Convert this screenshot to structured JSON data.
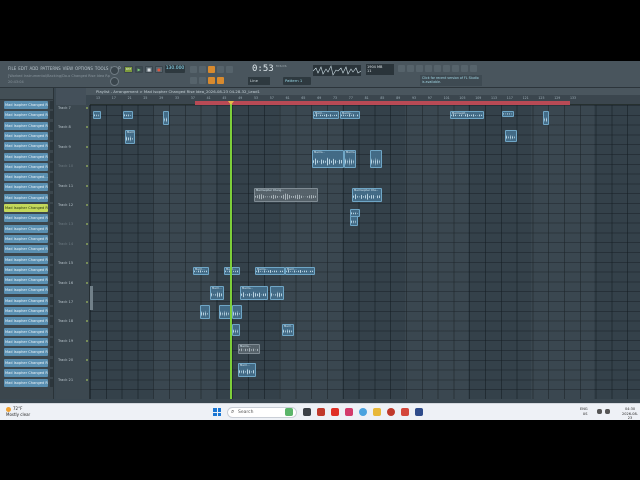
{
  "menu": [
    "FILE",
    "EDIT",
    "ADD",
    "PATTERNS",
    "VIEW",
    "OPTIONS",
    "TOOLS",
    "HELP"
  ],
  "project": {
    "title": "[Worked Instrumental/Backing/Do.o Changed Rise Idea Rp",
    "subtitle": "20:43:04"
  },
  "transport": {
    "pat_label": "PAT",
    "song_label": "SONG",
    "tempo": "130.000",
    "time": "0:53",
    "time_unit": "M:S:CS",
    "snap": "Line",
    "pattern": "Pattern 1"
  },
  "cpu": {
    "value": "1904 MB",
    "voices": "11"
  },
  "hint": "Click for recent version of FL Studio is available.",
  "playlist": {
    "title": "Playlist - Arrangement > Mad Isopher Changed Rise Idea_2026-08-23 04-28-32_Lead1"
  },
  "browser_items": [
    "Mad Isopher Changed Rise",
    "Mad Isopher Changed Rise",
    "Mad Isopher Changed Rise",
    "Mad Isopher Changed Rise",
    "Mad Isopher Changed Rise",
    "Mad Isopher Changed Rise",
    "Mad Isopher Changed Rise",
    "Mad Isopher Changed...",
    "Mad Isopher Changed Rise",
    "Mad Isopher Changed Rise",
    "Mad Isopher Changed Rise",
    "Mad Isopher Changed Rise",
    "Mad Isopher Changed Rise",
    "Mad Isopher Changed Rise",
    "Mad Isopher Changed Rise",
    "Mad Isopher Changed Rise",
    "Mad Isopher Changed Rise",
    "Mad Isopher Changed Rise",
    "Mad Isopher Changed Rise",
    "Mad Isopher Changed Rise",
    "Mad Isopher Changed Rise",
    "Mad Isopher Changed Rise",
    "Mad Isopher Changed Rise",
    "Mad Isopher Changed Rise",
    "Mad Isopher Changed Rise",
    "Mad Isopher Changed Rise",
    "Mad Isopher Changed Rise",
    "Mad Isopher Changed Rise"
  ],
  "selected_browser_index": 10,
  "tracks": [
    {
      "name": "Track 7",
      "dim": false
    },
    {
      "name": "Track 8",
      "dim": false
    },
    {
      "name": "Track 9",
      "dim": false
    },
    {
      "name": "Track 10",
      "dim": true
    },
    {
      "name": "Track 11",
      "dim": false
    },
    {
      "name": "Track 12",
      "dim": false
    },
    {
      "name": "Track 13",
      "dim": true
    },
    {
      "name": "Track 14",
      "dim": true
    },
    {
      "name": "Track 15",
      "dim": false
    },
    {
      "name": "Track 16",
      "dim": false
    },
    {
      "name": "Track 17",
      "dim": false
    },
    {
      "name": "Track 18",
      "dim": false
    },
    {
      "name": "Track 19",
      "dim": false
    },
    {
      "name": "Track 20",
      "dim": false
    },
    {
      "name": "Track 21",
      "dim": false
    }
  ],
  "ruler_numbers": [
    "13",
    "17",
    "21",
    "25",
    "29",
    "33",
    "37",
    "41",
    "45",
    "49",
    "53",
    "57",
    "61",
    "65",
    "69",
    "73",
    "77",
    "81",
    "85",
    "89",
    "93",
    "97",
    "101",
    "105",
    "109",
    "113",
    "117",
    "121",
    "125",
    "129",
    "133"
  ],
  "clips": [
    {
      "label": "",
      "grey": false
    },
    {
      "label": "",
      "grey": false
    },
    {
      "label": "",
      "grey": false
    },
    {
      "label": "Mad I...",
      "grey": false
    },
    {
      "label": "Mad Is...",
      "grey": false
    },
    {
      "label": "Mad Isoph...",
      "grey": false
    },
    {
      "label": "",
      "grey": false
    },
    {
      "label": "",
      "grey": false
    },
    {
      "label": "Mad Is...",
      "grey": false
    },
    {
      "label": "",
      "grey": false
    },
    {
      "label": "Mad Is...",
      "grey": false
    },
    {
      "label": "Mad Is...",
      "grey": false
    },
    {
      "label": "",
      "grey": false
    },
    {
      "label": "Mad Isopher Chang...",
      "grey": true
    },
    {
      "label": "Mad Isopher Cha...",
      "grey": false
    },
    {
      "label": "",
      "grey": false
    },
    {
      "label": "",
      "grey": false
    },
    {
      "label": "Mad I...",
      "grey": false
    },
    {
      "label": "Mad I...",
      "grey": false
    },
    {
      "label": "Mad Is...",
      "grey": false
    },
    {
      "label": "Mad I...",
      "grey": false
    },
    {
      "label": "Mad I...",
      "grey": false
    },
    {
      "label": "Mad Is...",
      "grey": false
    },
    {
      "label": "",
      "grey": false
    },
    {
      "label": "",
      "grey": false
    },
    {
      "label": "",
      "grey": false
    },
    {
      "label": "",
      "grey": false
    },
    {
      "label": "",
      "grey": false
    },
    {
      "label": "Mad I...",
      "grey": false
    },
    {
      "label": "Mad Is...",
      "grey": true
    },
    {
      "label": "Mad I...",
      "grey": false
    }
  ],
  "taskbar": {
    "weather_temp": "72°F",
    "weather_desc": "Mostly clear",
    "search_placeholder": "Search",
    "tray_lang": "ENG",
    "tray_region": "US",
    "time": "04:30",
    "date": "2026-08-23"
  }
}
